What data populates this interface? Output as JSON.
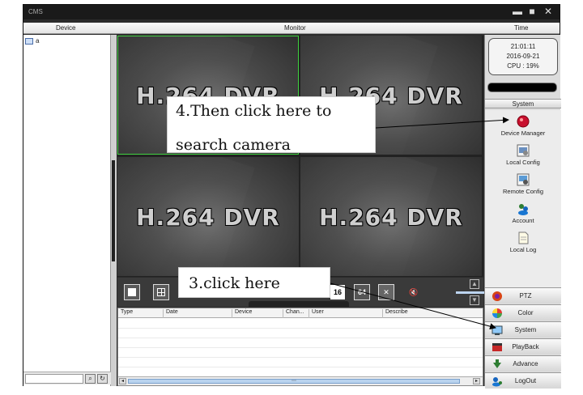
{
  "window": {
    "title": "CMS",
    "controls": [
      "▬",
      "■",
      "✕"
    ]
  },
  "column_headers": {
    "device": "Device",
    "monitor": "Monitor",
    "time": "Time"
  },
  "device_tree": {
    "root_label": "a"
  },
  "video": {
    "tile_logo": "H.264 DVR"
  },
  "toolbar": {
    "badge_16": "16",
    "badge_64": "64"
  },
  "log_table": {
    "columns": [
      "Type",
      "Date",
      "Device",
      "Chan...",
      "User",
      "Describe"
    ]
  },
  "clock": {
    "time": "21:01:11",
    "date": "2016-09-21",
    "cpu": "CPU : 19%"
  },
  "system_header": "System",
  "system_items": [
    {
      "label": "Device Manager",
      "icon": "device-manager-icon"
    },
    {
      "label": "Local Config",
      "icon": "local-config-icon"
    },
    {
      "label": "Remote Config",
      "icon": "remote-config-icon"
    },
    {
      "label": "Account",
      "icon": "account-icon"
    },
    {
      "label": "Local Log",
      "icon": "local-log-icon"
    }
  ],
  "menu": [
    {
      "label": "PTZ",
      "icon": "ptz-icon"
    },
    {
      "label": "Color",
      "icon": "color-icon"
    },
    {
      "label": "System",
      "icon": "system-icon"
    },
    {
      "label": "PlayBack",
      "icon": "playback-icon"
    },
    {
      "label": "Advance",
      "icon": "advance-icon"
    },
    {
      "label": "LogOut",
      "icon": "logout-icon"
    }
  ],
  "annotations": {
    "step4_line1": "4.Then click here to",
    "step4_line2": "search camera",
    "step3": "3.click here"
  },
  "colors": {
    "selected_tile": "#3ed13e",
    "window_bg": "#2b2b2b",
    "panel_bg": "#dcdcdc"
  }
}
